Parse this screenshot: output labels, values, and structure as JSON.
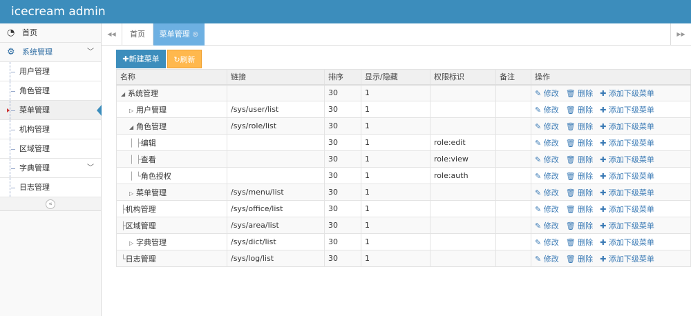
{
  "app_title": "icecream admin",
  "sidebar": {
    "home": "首页",
    "group": "系统管理",
    "items": [
      "用户管理",
      "角色管理",
      "菜单管理",
      "机构管理",
      "区域管理",
      "字典管理",
      "日志管理"
    ],
    "collapse": "«"
  },
  "tabs": {
    "prev": "◀◀",
    "home": "首页",
    "active": "菜单管理",
    "close": "⊗",
    "next": "▶▶"
  },
  "toolbar": {
    "new": "✚新建菜单",
    "refresh": "↻刷新"
  },
  "table": {
    "headers": [
      "名称",
      "链接",
      "排序",
      "显示/隐藏",
      "权限标识",
      "备注",
      "操作"
    ],
    "ops": {
      "edit": "✎ 修改",
      "del": "🗑 删除",
      "add": "✚ 添加下级菜单"
    },
    "rows": [
      {
        "prefix": "◢",
        "indent": 0,
        "name": "系统管理",
        "link": "",
        "order": "30",
        "show": "1",
        "perm": ""
      },
      {
        "prefix": "▷",
        "indent": 1,
        "name": "用户管理",
        "link": "/sys/user/list",
        "order": "30",
        "show": "1",
        "perm": ""
      },
      {
        "prefix": "◢",
        "indent": 1,
        "name": "角色管理",
        "link": "/sys/role/list",
        "order": "30",
        "show": "1",
        "perm": ""
      },
      {
        "prefix": "│ ├",
        "indent": 1,
        "name": "编辑",
        "link": "",
        "order": "30",
        "show": "1",
        "perm": "role:edit"
      },
      {
        "prefix": "│ ├",
        "indent": 1,
        "name": "查看",
        "link": "",
        "order": "30",
        "show": "1",
        "perm": "role:view"
      },
      {
        "prefix": "│ └",
        "indent": 1,
        "name": "角色授权",
        "link": "",
        "order": "30",
        "show": "1",
        "perm": "role:auth"
      },
      {
        "prefix": "▷",
        "indent": 1,
        "name": "菜单管理",
        "link": "/sys/menu/list",
        "order": "30",
        "show": "1",
        "perm": ""
      },
      {
        "prefix": "├",
        "indent": 0,
        "name": "机构管理",
        "link": "/sys/office/list",
        "order": "30",
        "show": "1",
        "perm": ""
      },
      {
        "prefix": "├",
        "indent": 0,
        "name": "区域管理",
        "link": "/sys/area/list",
        "order": "30",
        "show": "1",
        "perm": ""
      },
      {
        "prefix": "▷",
        "indent": 1,
        "name": "字典管理",
        "link": "/sys/dict/list",
        "order": "30",
        "show": "1",
        "perm": ""
      },
      {
        "prefix": "└",
        "indent": 0,
        "name": "日志管理",
        "link": "/sys/log/list",
        "order": "30",
        "show": "1",
        "perm": ""
      }
    ]
  }
}
